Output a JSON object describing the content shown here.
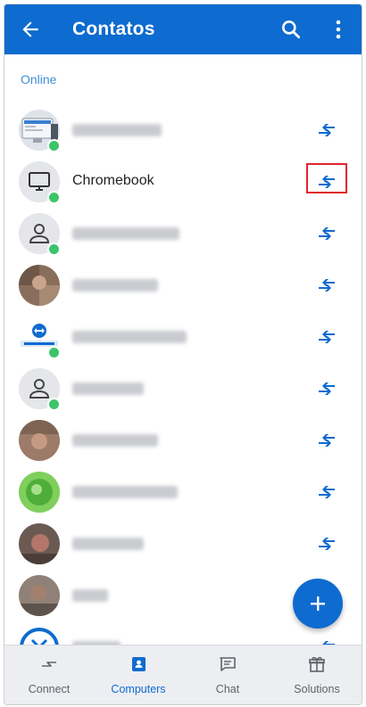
{
  "appbar": {
    "title": "Contatos"
  },
  "section": {
    "header": "Online"
  },
  "contacts": [
    {
      "name": "",
      "avatar": "computer-image",
      "online": true,
      "blurred": true,
      "blur_width": 100
    },
    {
      "name": "Chromebook",
      "avatar": "monitor-icon",
      "online": true,
      "blurred": false,
      "highlighted": true
    },
    {
      "name": "",
      "avatar": "person-icon",
      "online": true,
      "blurred": true,
      "blur_width": 120
    },
    {
      "name": "",
      "avatar": "photo",
      "online": false,
      "blurred": true,
      "blur_width": 96
    },
    {
      "name": "",
      "avatar": "teamviewer-logo",
      "online": true,
      "blurred": true,
      "blur_width": 128
    },
    {
      "name": "",
      "avatar": "person-icon",
      "online": true,
      "blurred": true,
      "blur_width": 80
    },
    {
      "name": "",
      "avatar": "photo",
      "online": false,
      "blurred": true,
      "blur_width": 96
    },
    {
      "name": "",
      "avatar": "photo",
      "online": false,
      "blurred": true,
      "blur_width": 118
    },
    {
      "name": "",
      "avatar": "photo",
      "online": false,
      "blurred": true,
      "blur_width": 80
    },
    {
      "name": "",
      "avatar": "photo",
      "online": false,
      "blurred": true,
      "blur_width": 40
    },
    {
      "name": "",
      "avatar": "logo-partial",
      "online": false,
      "blurred": true,
      "blur_width": 54
    }
  ],
  "bottom_nav": [
    {
      "label": "Connect",
      "icon": "connect-arrows-icon",
      "active": false
    },
    {
      "label": "Computers",
      "icon": "contacts-book-icon",
      "active": true
    },
    {
      "label": "Chat",
      "icon": "chat-bubble-icon",
      "active": false
    },
    {
      "label": "Solutions",
      "icon": "gift-icon",
      "active": false
    }
  ],
  "colors": {
    "primary": "#0e6bcf",
    "online": "#3cc46a",
    "highlight": "#e0262b"
  }
}
